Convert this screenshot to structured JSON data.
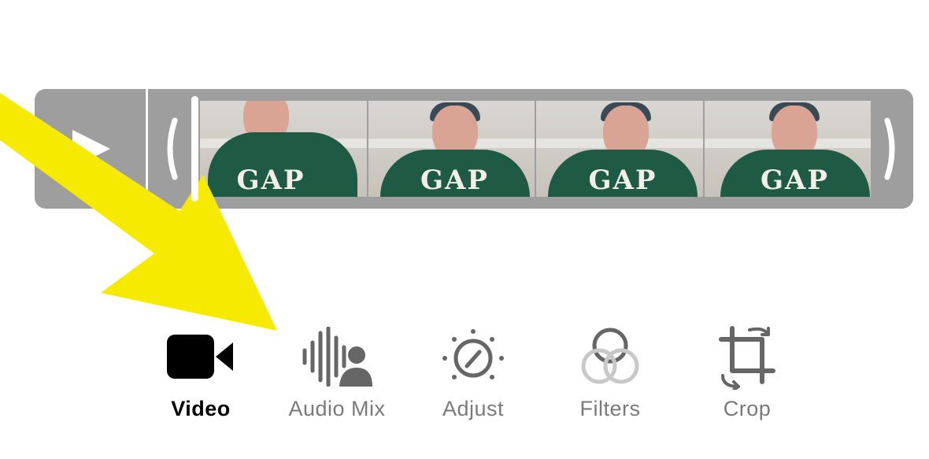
{
  "toolbar": {
    "items": [
      {
        "label": "Video",
        "icon": "video-camera-icon",
        "active": true
      },
      {
        "label": "Audio Mix",
        "icon": "audio-mix-icon",
        "active": false
      },
      {
        "label": "Adjust",
        "icon": "adjust-dial-icon",
        "active": false
      },
      {
        "label": "Filters",
        "icon": "filters-icon",
        "active": false
      },
      {
        "label": "Crop",
        "icon": "crop-rotate-icon",
        "active": false
      }
    ]
  },
  "timeline": {
    "play_icon": "play-icon",
    "trim_left_icon": "trim-handle-left-icon",
    "trim_right_icon": "trim-handle-right-icon",
    "frame_text": "GAP"
  },
  "colors": {
    "timeline_bg": "#9e9e9e",
    "arrow": "#f5ea00",
    "active_label": "#000000",
    "inactive_label": "#7a7a7a"
  }
}
